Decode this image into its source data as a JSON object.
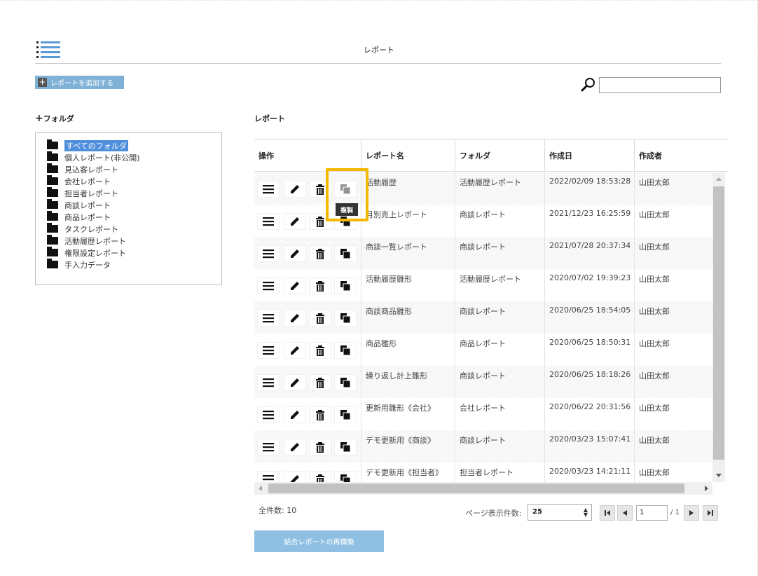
{
  "header": {
    "title": "レポート"
  },
  "toolbar": {
    "add_label": "レポートを追加する",
    "search_placeholder": "",
    "search_value": ""
  },
  "folders": {
    "heading": "フォルダ",
    "items": [
      {
        "label": "すべてのフォルダ",
        "selected": true
      },
      {
        "label": "個人レポート(非公開)"
      },
      {
        "label": "見込客レポート"
      },
      {
        "label": "会社レポート"
      },
      {
        "label": "担当者レポート"
      },
      {
        "label": "商談レポート"
      },
      {
        "label": "商品レポート"
      },
      {
        "label": "タスクレポート"
      },
      {
        "label": "活動履歴レポート"
      },
      {
        "label": "権限設定レポート"
      },
      {
        "label": "手入力データ"
      }
    ]
  },
  "reports": {
    "heading": "レポート",
    "columns": {
      "ops": "操作",
      "name": "レポート名",
      "folder": "フォルダ",
      "created": "作成日",
      "author": "作成者"
    },
    "rows": [
      {
        "name": "活動履歴",
        "folder": "活動履歴レポート",
        "created": "2022/02/09 18:53:28",
        "author": "山田太郎"
      },
      {
        "name": "月別売上レポート",
        "folder": "商談レポート",
        "created": "2021/12/23 16:25:59",
        "author": "山田太郎"
      },
      {
        "name": "商談一覧レポート",
        "folder": "商談レポート",
        "created": "2021/07/28 20:37:34",
        "author": "山田太郎"
      },
      {
        "name": "活動履歴雛形",
        "folder": "活動履歴レポート",
        "created": "2020/07/02 19:39:23",
        "author": "山田太郎"
      },
      {
        "name": "商談商品雛形",
        "folder": "商談レポート",
        "created": "2020/06/25 18:54:05",
        "author": "山田太郎"
      },
      {
        "name": "商品雛形",
        "folder": "商品レポート",
        "created": "2020/06/25 18:50:31",
        "author": "山田太郎"
      },
      {
        "name": "繰り返し計上雛形",
        "folder": "商談レポート",
        "created": "2020/06/25 18:18:26",
        "author": "山田太郎"
      },
      {
        "name": "更新用雛形《会社》",
        "folder": "会社レポート",
        "created": "2020/06/22 20:31:56",
        "author": "山田太郎"
      },
      {
        "name": "デモ更新用《商談》",
        "folder": "商談レポート",
        "created": "2020/03/23 15:07:41",
        "author": "山田太郎"
      },
      {
        "name": "デモ更新用《担当者》",
        "folder": "担当者レポート",
        "created": "2020/03/23 14:21:11",
        "author": "山田太郎"
      }
    ],
    "tooltip": "複製"
  },
  "footer": {
    "total": "全件数: 10",
    "page_size_label": "ページ表示件数:",
    "page_size": "25",
    "page": "1",
    "page_total": "/ 1",
    "rebuild_label": "結合レポートの再構築"
  },
  "colors": {
    "accent": "#7fb1d7",
    "highlight": "#f5b800",
    "selected": "#4f8fdc"
  }
}
